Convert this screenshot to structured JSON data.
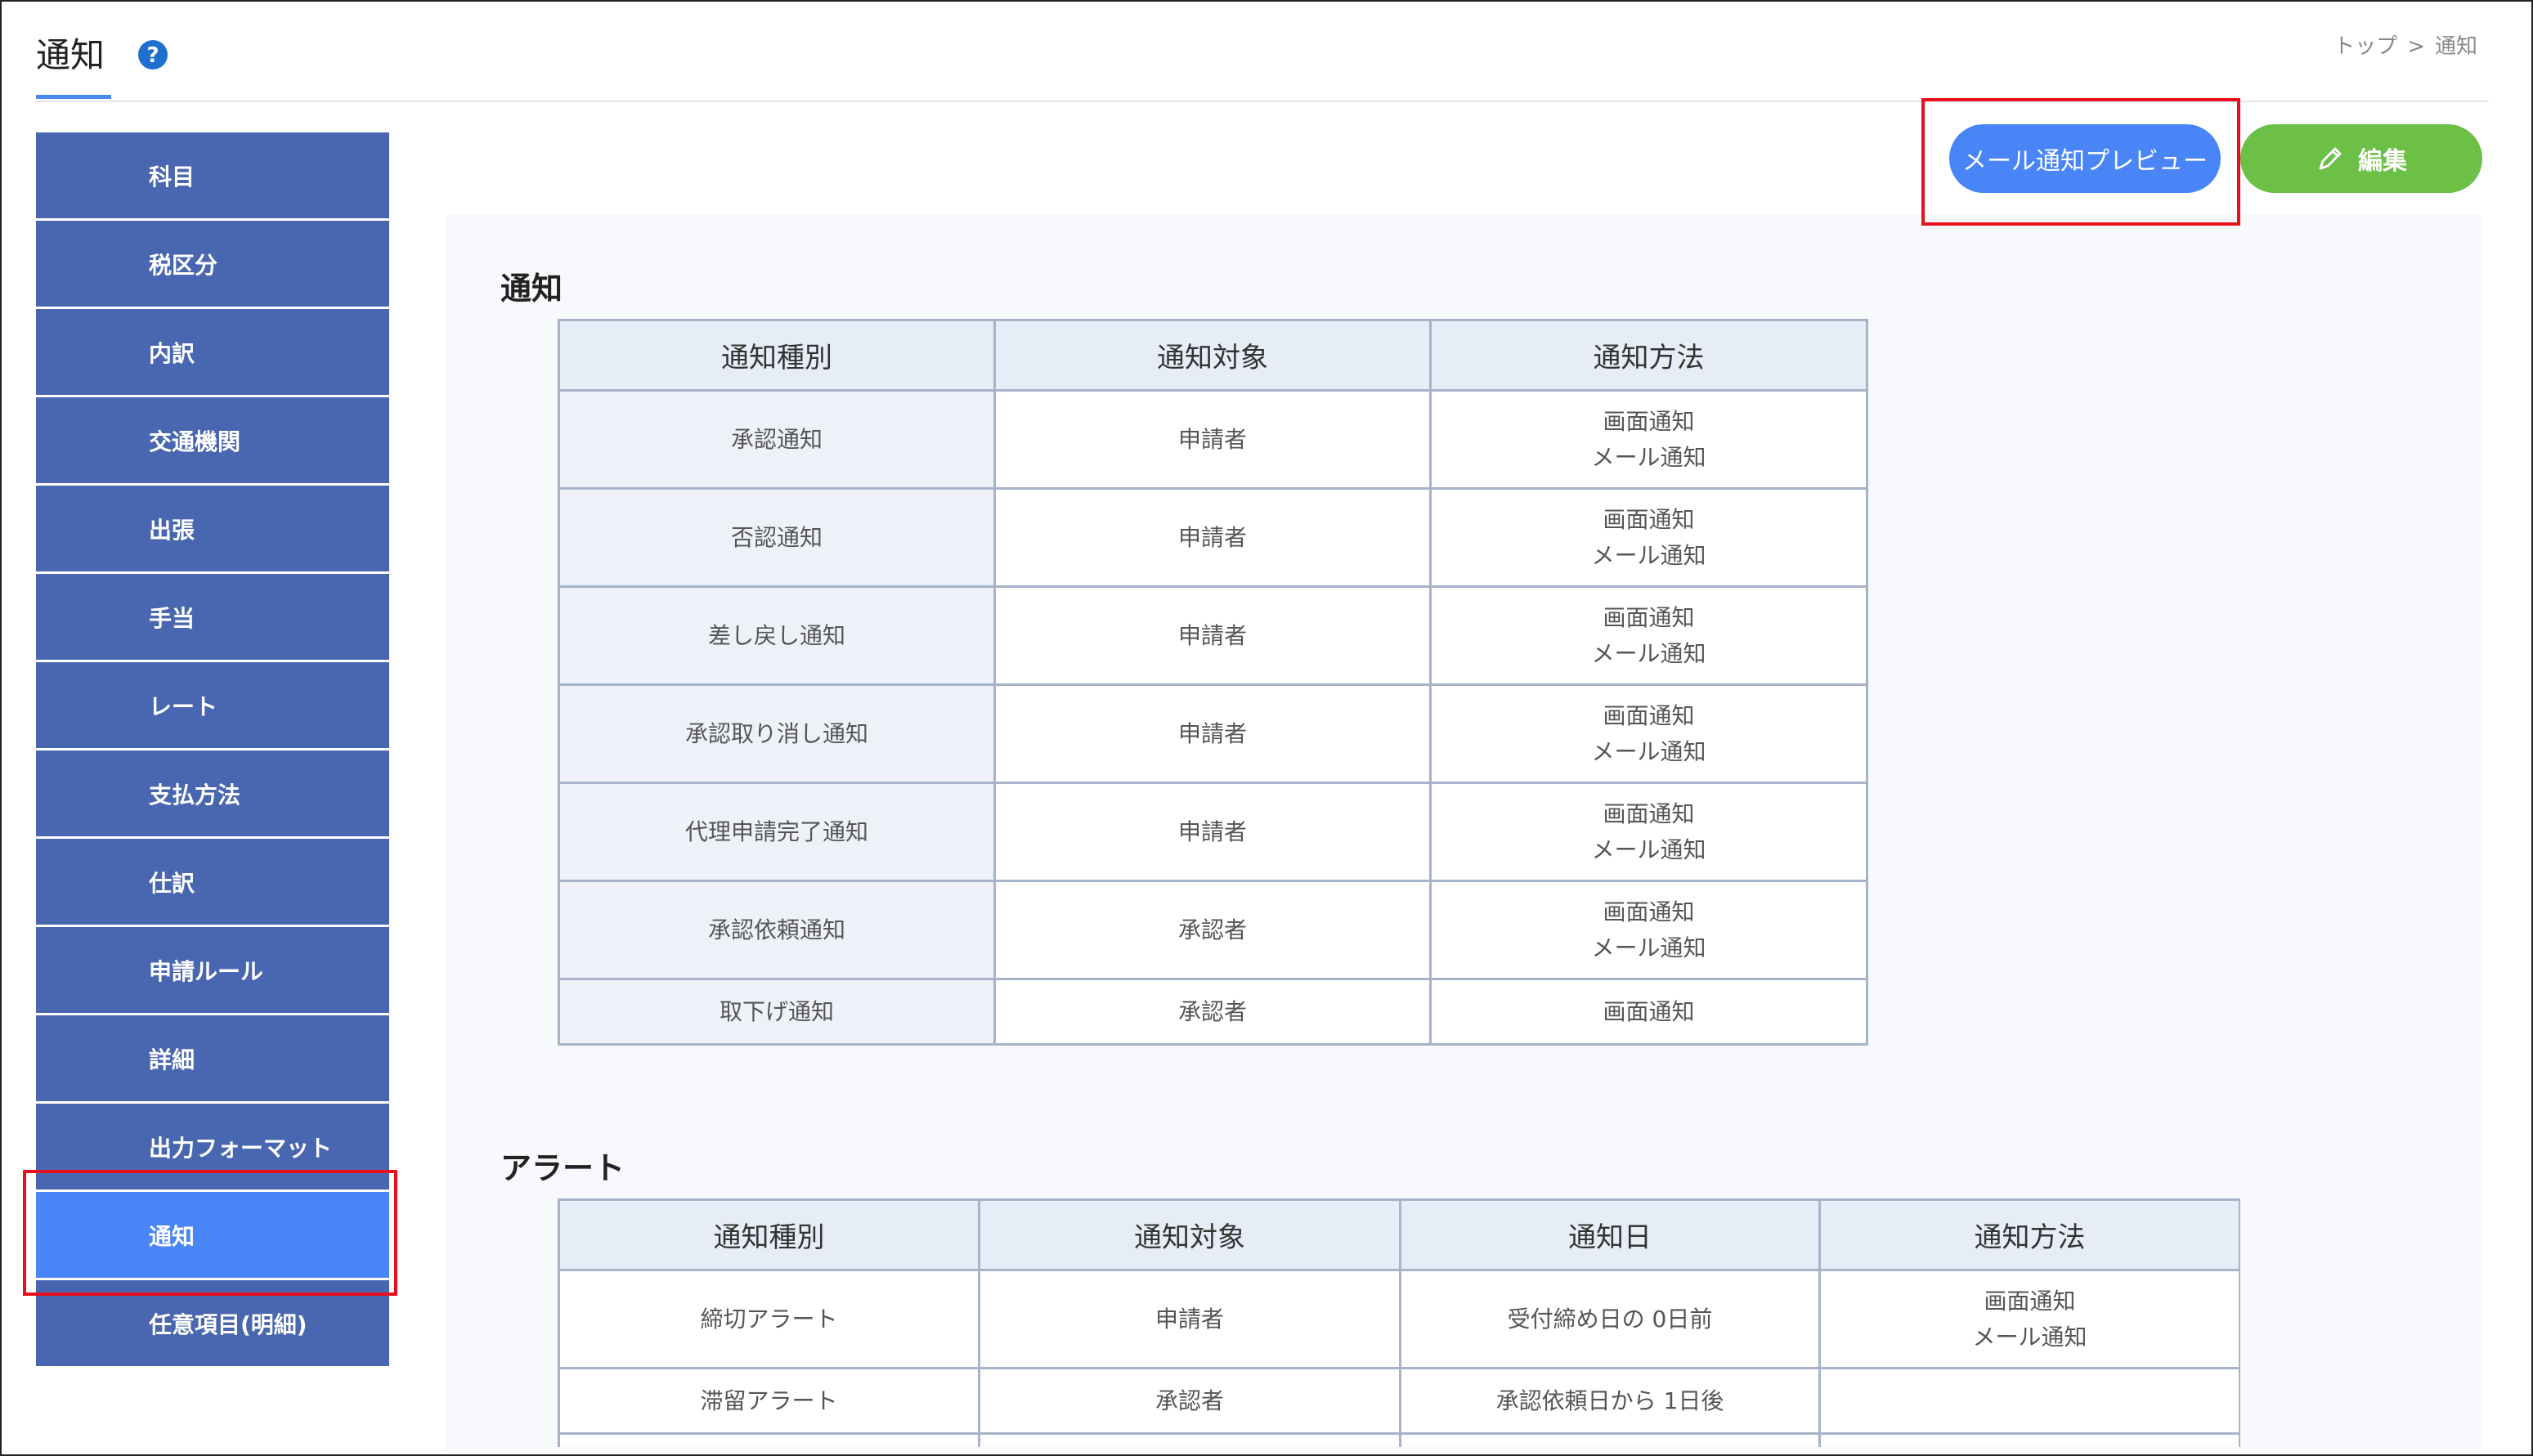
{
  "header": {
    "title": "通知",
    "breadcrumb": {
      "home": "トップ",
      "separator": ">",
      "current": "通知"
    }
  },
  "sidebar": {
    "items": [
      {
        "label": "科目"
      },
      {
        "label": "税区分"
      },
      {
        "label": "内訳"
      },
      {
        "label": "交通機関"
      },
      {
        "label": "出張"
      },
      {
        "label": "手当"
      },
      {
        "label": "レート"
      },
      {
        "label": "支払方法"
      },
      {
        "label": "仕訳"
      },
      {
        "label": "申請ルール"
      },
      {
        "label": "詳細"
      },
      {
        "label": "出力フォーマット"
      },
      {
        "label": "通知",
        "active": true
      },
      {
        "label": "任意項目(明細)"
      }
    ]
  },
  "actions": {
    "preview_label": "メール通知プレビュー",
    "edit_label": "編集"
  },
  "notifications": {
    "section_title": "通知",
    "headers": [
      "通知種別",
      "通知対象",
      "通知方法"
    ],
    "rows": [
      {
        "type": "承認通知",
        "target": "申請者",
        "methods": [
          "画面通知",
          "メール通知"
        ]
      },
      {
        "type": "否認通知",
        "target": "申請者",
        "methods": [
          "画面通知",
          "メール通知"
        ]
      },
      {
        "type": "差し戻し通知",
        "target": "申請者",
        "methods": [
          "画面通知",
          "メール通知"
        ]
      },
      {
        "type": "承認取り消し通知",
        "target": "申請者",
        "methods": [
          "画面通知",
          "メール通知"
        ]
      },
      {
        "type": "代理申請完了通知",
        "target": "申請者",
        "methods": [
          "画面通知",
          "メール通知"
        ]
      },
      {
        "type": "承認依頼通知",
        "target": "承認者",
        "methods": [
          "画面通知",
          "メール通知"
        ]
      },
      {
        "type": "取下げ通知",
        "target": "承認者",
        "methods": [
          "画面通知"
        ]
      }
    ]
  },
  "alerts": {
    "section_title": "アラート",
    "headers": [
      "通知種別",
      "通知対象",
      "通知日",
      "通知方法"
    ],
    "rows": [
      {
        "type": "締切アラート",
        "target": "申請者",
        "date": "受付締め日の 0日前",
        "methods": [
          "画面通知",
          "メール通知"
        ]
      },
      {
        "type": "滞留アラート",
        "target": "承認者",
        "date": "承認依頼日から 1日後",
        "methods": []
      }
    ]
  },
  "colors": {
    "sidebar": "#4967b0",
    "sidebar_active": "#4a85f7",
    "preview_button": "#4a85f7",
    "edit_button": "#6cc046",
    "highlight_box": "#e8101c",
    "table_border": "#a6b3c9",
    "table_header_bg": "#e7edf6"
  },
  "icons": {
    "help": "question-circle-icon",
    "edit": "pencil-icon"
  }
}
